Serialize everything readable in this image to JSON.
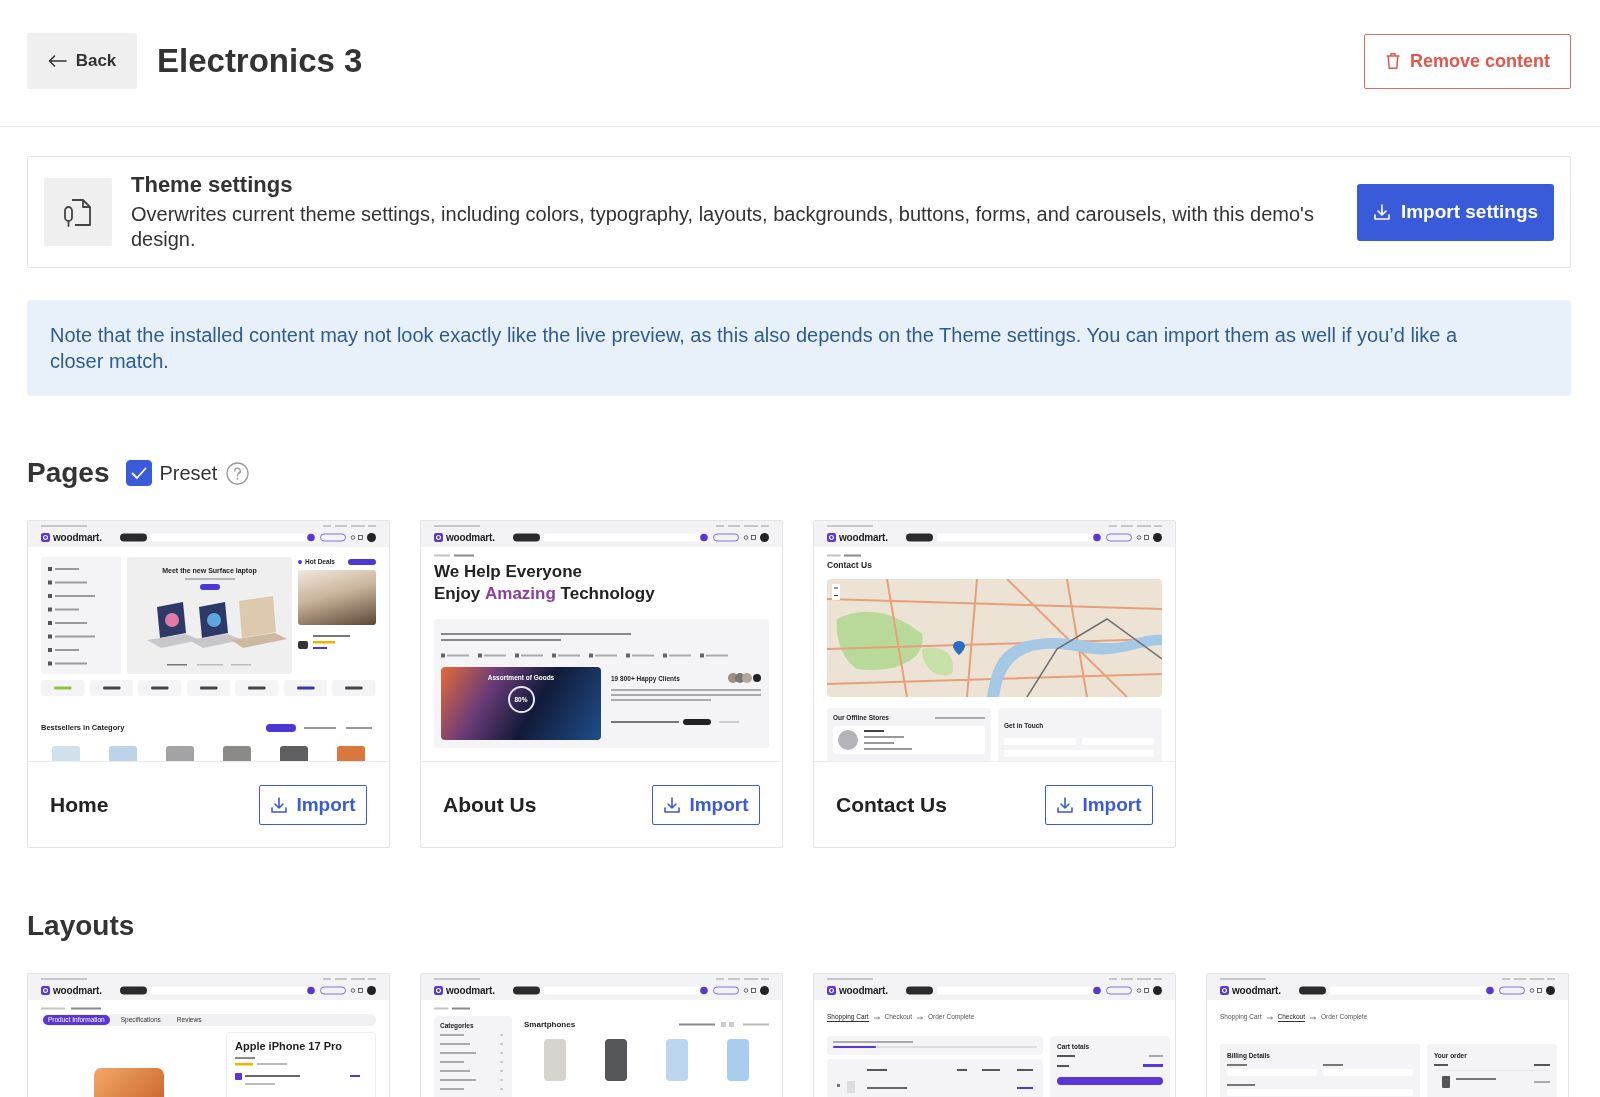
{
  "header": {
    "back_label": "Back",
    "title": "Electronics 3",
    "remove_label": "Remove content"
  },
  "theme_settings": {
    "title": "Theme settings",
    "description": "Overwrites current theme settings, including colors, typography, layouts, backgrounds, buttons, forms, and carousels, with this demo's design.",
    "button": "Import settings"
  },
  "note": "Note that the installed content may not look exactly like the live preview, as this also depends on the Theme settings. You can import them as well if you’d like a closer match.",
  "pages": {
    "heading": "Pages",
    "preset": {
      "label": "Preset",
      "checked": true
    },
    "items": [
      {
        "title": "Home",
        "button": "Import",
        "preview": {
          "kind": "home",
          "logo": "woodmart.",
          "hero_title": "Meet the new Surface laptop",
          "deals_label": "Hot Deals",
          "section_title": "Bestsellers in Category"
        }
      },
      {
        "title": "About Us",
        "button": "Import",
        "preview": {
          "kind": "about",
          "logo": "woodmart.",
          "title_lines": [
            "We Help Everyone",
            "Enjoy **Amazing** Technology"
          ],
          "promo_title": "Assortment of Goods",
          "ring_label": "80%",
          "clients_label": "19 800+ Happy Clients"
        }
      },
      {
        "title": "Contact Us",
        "button": "Import",
        "preview": {
          "kind": "contact",
          "logo": "woodmart.",
          "title": "Contact Us",
          "stores_title": "Our Offline Stores",
          "form_title": "Get in Touch"
        }
      }
    ]
  },
  "layouts": {
    "heading": "Layouts",
    "items": [
      {
        "preview": {
          "kind": "product",
          "logo": "woodmart.",
          "tabs": [
            {
              "label": "Product Information",
              "selected": true
            },
            {
              "label": "Specifications",
              "selected": false
            },
            {
              "label": "Reviews",
              "selected": false
            }
          ],
          "title": "Apple iPhone 17 Pro"
        }
      },
      {
        "preview": {
          "kind": "shop",
          "logo": "woodmart.",
          "sidebar_title": "Categories",
          "title": "Smartphones"
        }
      },
      {
        "preview": {
          "kind": "cart",
          "logo": "woodmart.",
          "steps": [
            {
              "label": "Shopping Cart",
              "selected": true
            },
            {
              "label": "Checkout",
              "selected": false
            },
            {
              "label": "Order Complete",
              "selected": false
            }
          ],
          "shipping_progress": {
            "level": 0.21
          },
          "totals_title": "Cart totals"
        }
      },
      {
        "preview": {
          "kind": "checkout",
          "logo": "woodmart.",
          "steps": [
            {
              "label": "Shopping Cart",
              "selected": false
            },
            {
              "label": "Checkout",
              "selected": true
            },
            {
              "label": "Order Complete",
              "selected": false
            }
          ],
          "billing_title": "Billing Details",
          "order_title": "Your order"
        }
      }
    ]
  }
}
